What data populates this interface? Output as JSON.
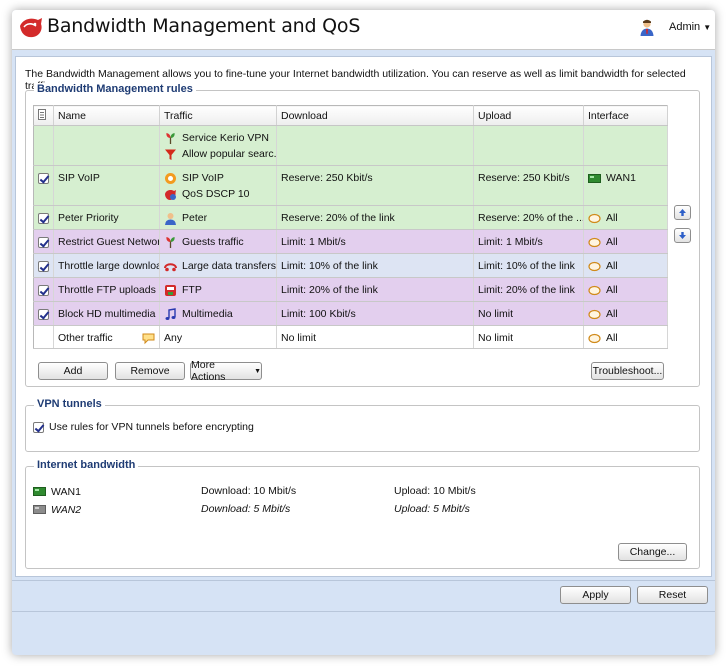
{
  "app": {
    "title": "Bandwidth Management and QoS"
  },
  "user": {
    "name": "Admin"
  },
  "intro": "The Bandwidth Management allows you to fine-tune your Internet bandwidth utilization. You can reserve as well as limit bandwidth for selected traffic.",
  "rules_section": {
    "title": "Bandwidth Management rules",
    "columns": [
      "Name",
      "Traffic",
      "Download",
      "Upload",
      "Interface"
    ],
    "rows": [
      {
        "checked": null,
        "name": "",
        "traffic": [
          {
            "icon": "kerio-vpn-icon",
            "text": "Service Kerio VPN"
          },
          {
            "icon": "filter-icon",
            "text": "Allow popular searc..."
          }
        ],
        "download": "",
        "upload": "",
        "interface": {
          "icon": "",
          "text": ""
        },
        "color": "green"
      },
      {
        "checked": true,
        "name": "SIP VoIP",
        "traffic": [
          {
            "icon": "sip-icon",
            "text": "SIP VoIP"
          },
          {
            "icon": "qos-icon",
            "text": "QoS DSCP 10"
          }
        ],
        "download": "Reserve: 250 Kbit/s",
        "upload": "Reserve: 250 Kbit/s",
        "interface": {
          "icon": "wan-icon",
          "text": "WAN1"
        },
        "color": "green"
      },
      {
        "checked": true,
        "name": "Peter Priority",
        "traffic": [
          {
            "icon": "user-icon",
            "text": "Peter"
          }
        ],
        "download": "Reserve: 20% of the link",
        "upload": "Reserve: 20% of the ...",
        "interface": {
          "icon": "all-icon",
          "text": "All"
        },
        "color": "green"
      },
      {
        "checked": true,
        "name": "Restrict Guest Network",
        "traffic": [
          {
            "icon": "guests-icon",
            "text": "Guests traffic"
          }
        ],
        "download": "Limit: 1 Mbit/s",
        "upload": "Limit: 1 Mbit/s",
        "interface": {
          "icon": "all-icon",
          "text": "All"
        },
        "color": "purple"
      },
      {
        "checked": true,
        "name": "Throttle large downloa...",
        "traffic": [
          {
            "icon": "large-data-icon",
            "text": "Large data transfers"
          }
        ],
        "download": "Limit: 10% of the link",
        "upload": "Limit: 10% of the link",
        "interface": {
          "icon": "all-icon",
          "text": "All"
        },
        "color": "blue"
      },
      {
        "checked": true,
        "name": "Throttle FTP uploads",
        "traffic": [
          {
            "icon": "ftp-icon",
            "text": "FTP"
          }
        ],
        "download": "Limit: 20% of the link",
        "upload": "Limit: 20% of the link",
        "interface": {
          "icon": "all-icon",
          "text": "All"
        },
        "color": "purple"
      },
      {
        "checked": true,
        "name": "Block HD multimedia",
        "traffic": [
          {
            "icon": "music-icon",
            "text": "Multimedia"
          }
        ],
        "download": "Limit: 100 Kbit/s",
        "upload": "No limit",
        "interface": {
          "icon": "all-icon",
          "text": "All"
        },
        "color": "purple"
      },
      {
        "checked": null,
        "name": "Other traffic",
        "traffic": [
          {
            "icon": "",
            "text": "Any"
          }
        ],
        "download": "No limit",
        "upload": "No limit",
        "interface": {
          "icon": "all-icon",
          "text": "All"
        },
        "color": "white"
      }
    ],
    "buttons": {
      "add": "Add",
      "remove": "Remove",
      "more_actions": "More Actions",
      "troubleshoot": "Troubleshoot..."
    }
  },
  "vpn_section": {
    "title": "VPN tunnels",
    "checkbox_label": "Use rules for VPN tunnels before encrypting",
    "checked": true
  },
  "internet_section": {
    "title": "Internet bandwidth",
    "links": [
      {
        "name": "WAN1",
        "download": "Download: 10 Mbit/s",
        "upload": "Upload: 10 Mbit/s",
        "italic": false
      },
      {
        "name": "WAN2",
        "download": "Download: 5 Mbit/s",
        "upload": "Upload: 5 Mbit/s",
        "italic": true
      }
    ],
    "change_button": "Change..."
  },
  "footer": {
    "apply": "Apply",
    "reset": "Reset"
  }
}
